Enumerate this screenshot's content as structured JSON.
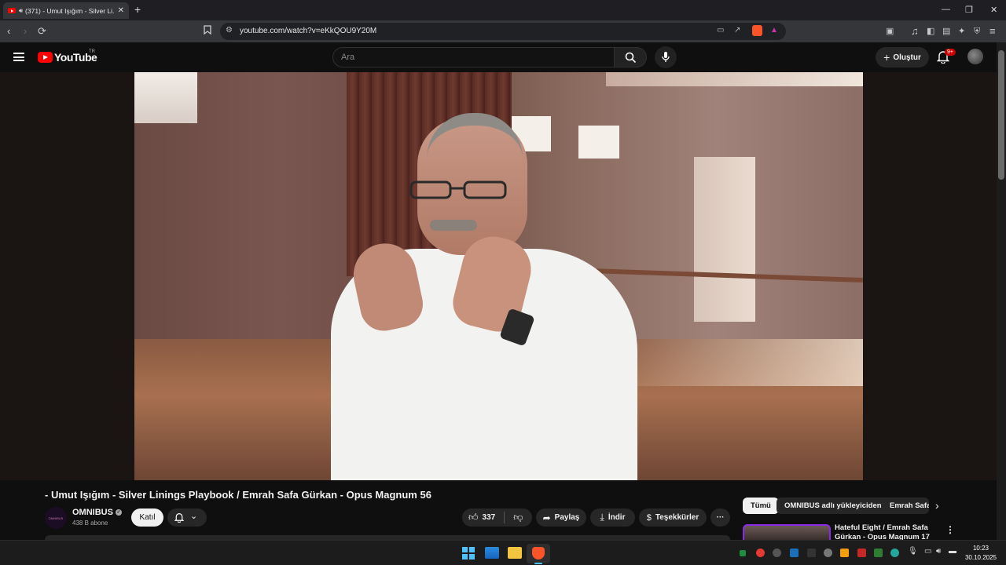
{
  "browser": {
    "tab_title": "(371) - Umut Işığım - Silver Li...",
    "url": "youtube.com/watch?v=eKkQOU9Y20M",
    "new_tab": "+",
    "tab_close": "✕",
    "minimize": "—",
    "restore": "❐",
    "close": "✕"
  },
  "youtube": {
    "logo_text": "YouTube",
    "country_code": "TR",
    "search_placeholder": "Ara",
    "create_label": "Oluştur",
    "notification_badge": "9+"
  },
  "video": {
    "title": "- Umut Işığım - Silver Linings Playbook / Emrah Safa Gürkan - Opus Magnum 56",
    "channel": "OMNIBUS",
    "channel_avatar_text": "OMNIBUS",
    "subscribers": "438 B abone",
    "join_label": "Katıl",
    "likes": "337",
    "share_label": "Paylaş",
    "download_label": "İndir",
    "thanks_label": "Teşekkürler",
    "more_label": "···"
  },
  "sidebar": {
    "chips": [
      "Tümü",
      "OMNIBUS adlı yükleyiciden",
      "Emrah Safa"
    ],
    "recommendation_title": "Hateful Eight / Emrah Safa Gürkan - Opus Magnum 17"
  },
  "taskbar": {
    "time": "10:23",
    "date": "30.10.2025"
  },
  "colors": {
    "youtube_red": "#ff0000",
    "background": "#0f0f0f",
    "accent_purple": "#8a2be2"
  }
}
